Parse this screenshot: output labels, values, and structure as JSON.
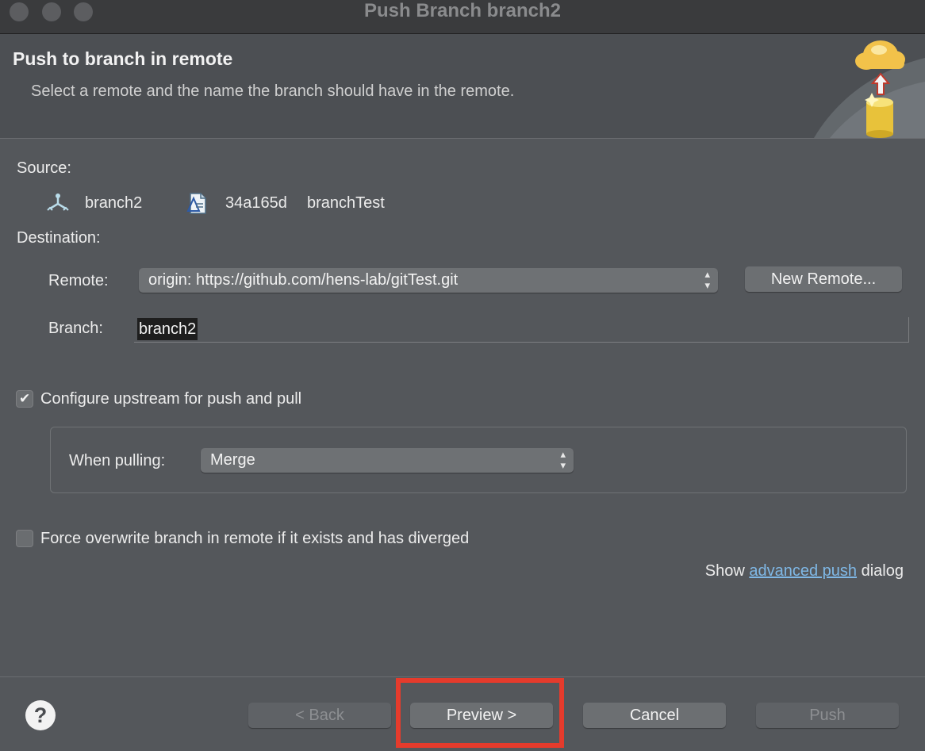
{
  "window": {
    "title": "Push Branch branch2"
  },
  "header": {
    "title": "Push to branch in remote",
    "subtitle": "Select a remote and the name the branch should have in the remote.",
    "image_icon": "cloud-push-database-icon"
  },
  "source": {
    "label": "Source:",
    "branch_icon": "branch-icon",
    "branch": "branch2",
    "commit_icon": "commit-icon",
    "commit_id": "34a165d",
    "commit_message": "branchTest"
  },
  "destination": {
    "label": "Destination:",
    "remote_label": "Remote:",
    "remote_value": "origin: https://github.com/hens-lab/gitTest.git",
    "new_remote_label": "New Remote...",
    "branch_label": "Branch:",
    "branch_value": "branch2"
  },
  "upstream": {
    "checked": true,
    "label": "Configure upstream for push and pull",
    "when_pulling_label": "When pulling:",
    "when_pulling_value": "Merge"
  },
  "force": {
    "checked": false,
    "label": "Force overwrite branch in remote if it exists and has diverged"
  },
  "advanced": {
    "prefix": "Show",
    "link": "advanced push",
    "suffix": "dialog"
  },
  "buttons": {
    "help": "?",
    "back": "< Back",
    "preview": "Preview >",
    "cancel": "Cancel",
    "push": "Push"
  },
  "colors": {
    "highlight": "#e53b2c",
    "link": "#7fb8e6",
    "background": "#54575b"
  }
}
